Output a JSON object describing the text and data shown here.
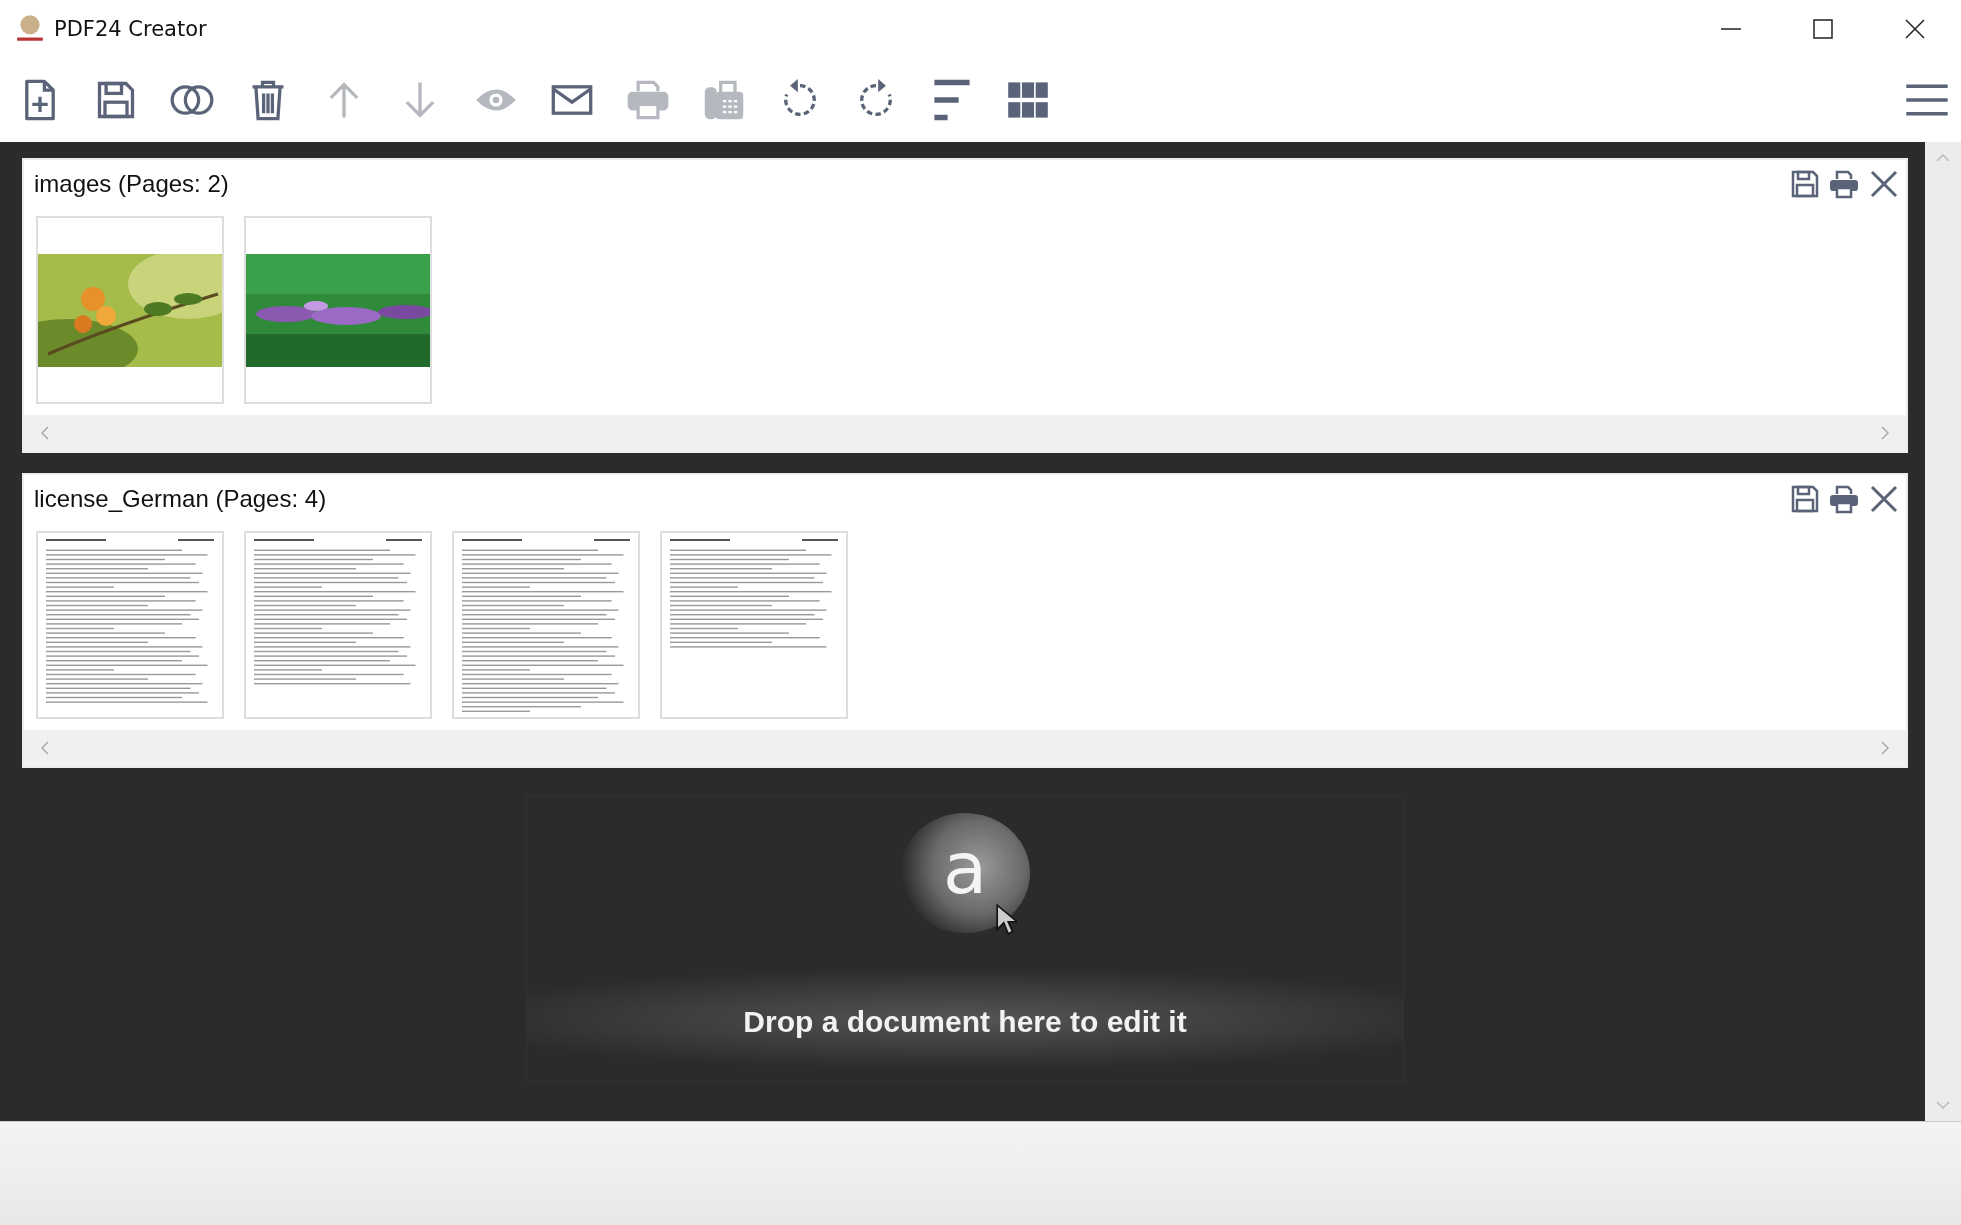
{
  "window": {
    "title": "PDF24 Creator"
  },
  "toolbar": [
    {
      "kind": "new",
      "disabled": false
    },
    {
      "kind": "save",
      "disabled": false
    },
    {
      "kind": "merge",
      "disabled": false
    },
    {
      "kind": "delete",
      "disabled": false
    },
    {
      "kind": "up",
      "disabled": true
    },
    {
      "kind": "down",
      "disabled": true
    },
    {
      "kind": "preview",
      "disabled": true
    },
    {
      "kind": "email",
      "disabled": false
    },
    {
      "kind": "print",
      "disabled": true
    },
    {
      "kind": "fax",
      "disabled": true
    },
    {
      "kind": "rotate-left",
      "disabled": false
    },
    {
      "kind": "rotate-right",
      "disabled": false
    },
    {
      "kind": "sort",
      "disabled": false
    },
    {
      "kind": "grid",
      "disabled": false
    }
  ],
  "documents": [
    {
      "title": "images (Pages: 2)"
    },
    {
      "title": "license_German (Pages: 4)",
      "pages": [
        {
          "kind": "text-page"
        },
        {
          "kind": "text-page"
        },
        {
          "kind": "text-page"
        },
        {
          "kind": "text-page"
        }
      ]
    }
  ],
  "drop_zone": {
    "graphic_letter": "a",
    "message": "Drop a document here to edit it"
  }
}
